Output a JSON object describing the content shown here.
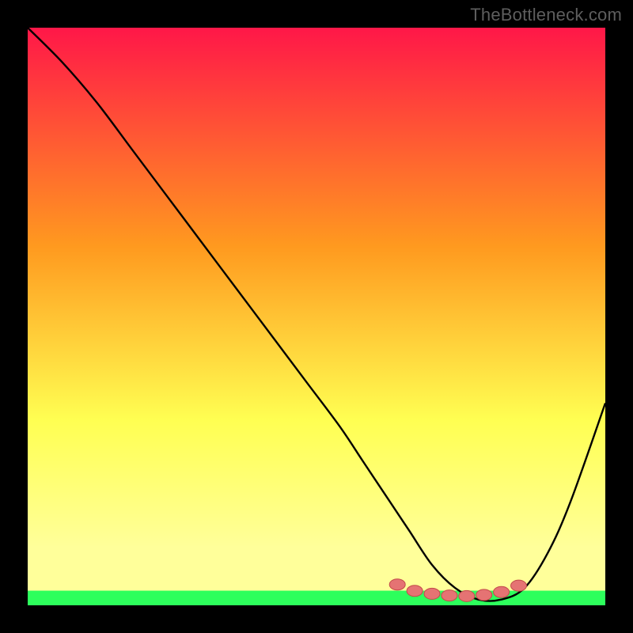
{
  "watermark": "TheBottleneck.com",
  "colors": {
    "black": "#000000",
    "red": "#ff1748",
    "orange": "#ff9a1f",
    "yellow": "#ffff52",
    "pale_yellow": "#ffff9a",
    "green": "#2dff5c",
    "curve": "#000000",
    "dot_fill": "#e57373",
    "dot_stroke": "#c24a4a"
  },
  "chart_data": {
    "type": "line",
    "title": "",
    "xlabel": "",
    "ylabel": "",
    "xlim": [
      0,
      100
    ],
    "ylim": [
      0,
      100
    ],
    "series": [
      {
        "name": "bottleneck-curve",
        "x": [
          0,
          6,
          12,
          18,
          24,
          30,
          36,
          42,
          48,
          54,
          58,
          62,
          66,
          70,
          74,
          78,
          82,
          86,
          90,
          94,
          100
        ],
        "y": [
          100,
          94,
          87,
          79,
          71,
          63,
          55,
          47,
          39,
          31,
          25,
          19,
          13,
          7,
          3,
          1,
          1,
          3,
          9,
          18,
          35
        ]
      }
    ],
    "markers": {
      "name": "optimal-region-dots",
      "x": [
        64,
        67,
        70,
        73,
        76,
        79,
        82,
        85
      ],
      "y": [
        3.6,
        2.5,
        2.0,
        1.7,
        1.6,
        1.8,
        2.3,
        3.4
      ]
    }
  }
}
